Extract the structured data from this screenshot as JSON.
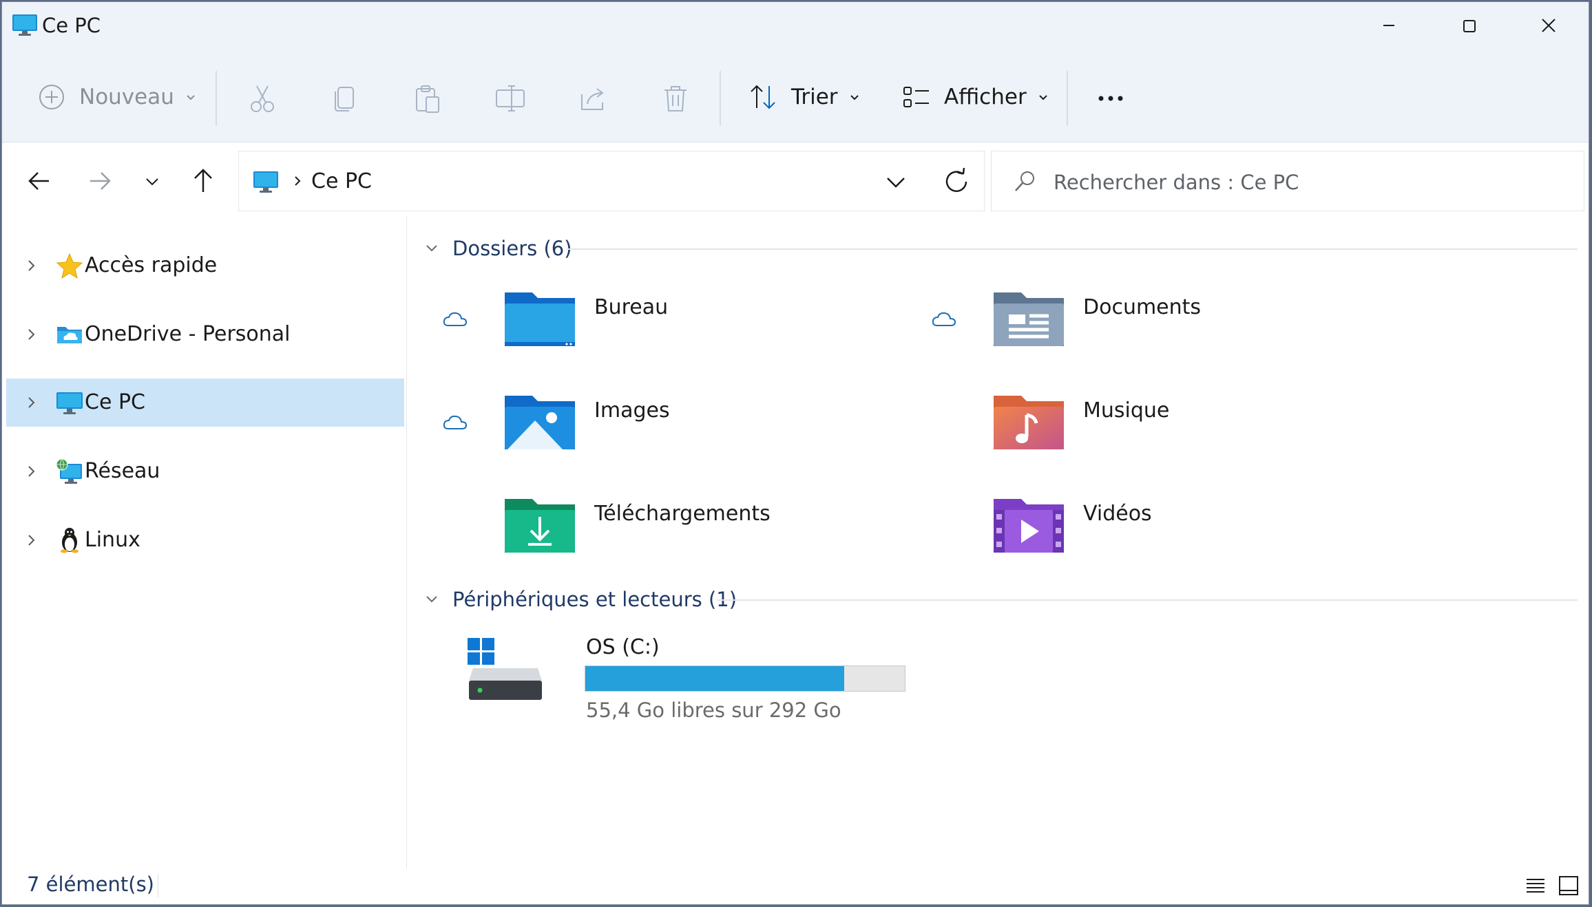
{
  "window": {
    "title": "Ce PC",
    "icon": "this-pc-icon",
    "controls": [
      "minimize-icon",
      "maximize-icon",
      "close-icon"
    ]
  },
  "toolbar": {
    "new_label": "Nouveau",
    "sort_label": "Trier",
    "view_label": "Afficher",
    "icons": [
      "add-icon",
      "cut-icon",
      "copy-icon",
      "paste-icon",
      "rename-icon",
      "share-icon",
      "delete-icon",
      "sort-icon",
      "view-icon",
      "more-icon"
    ]
  },
  "navigation": {
    "icons": [
      "back-icon",
      "forward-icon",
      "recent-dropdown-icon",
      "up-icon"
    ]
  },
  "address": {
    "path": "Ce PC"
  },
  "search": {
    "placeholder": "Rechercher dans : Ce PC"
  },
  "sidebar": {
    "items": [
      {
        "label": "Accès rapide",
        "icon": "star-icon"
      },
      {
        "label": "OneDrive - Personal",
        "icon": "onedrive-folder-icon"
      },
      {
        "label": "Ce PC",
        "icon": "this-pc-icon",
        "selected": true
      },
      {
        "label": "Réseau",
        "icon": "network-icon"
      },
      {
        "label": "Linux",
        "icon": "linux-penguin-icon"
      }
    ]
  },
  "content": {
    "folders_group": "Dossiers (6)",
    "folders": [
      {
        "label": "Bureau",
        "icon": "desktop-folder-icon",
        "cloud": true
      },
      {
        "label": "Documents",
        "icon": "documents-folder-icon",
        "cloud": true
      },
      {
        "label": "Images",
        "icon": "pictures-folder-icon",
        "cloud": true
      },
      {
        "label": "Musique",
        "icon": "music-folder-icon",
        "cloud": false
      },
      {
        "label": "Téléchargements",
        "icon": "downloads-folder-icon",
        "cloud": false
      },
      {
        "label": "Vidéos",
        "icon": "videos-folder-icon",
        "cloud": false
      }
    ],
    "devices_group": "Périphériques et lecteurs (1)",
    "drive": {
      "label": "OS (C:)",
      "free_text": "55,4 Go libres sur 292 Go",
      "used_fraction": 0.81,
      "bar_color": "#26a0da"
    }
  },
  "status": {
    "count": "7 élément(s)"
  },
  "colors": {
    "accent": "#0067c0",
    "selection": "#cce4f7",
    "titlebar": "#eef3f9"
  }
}
